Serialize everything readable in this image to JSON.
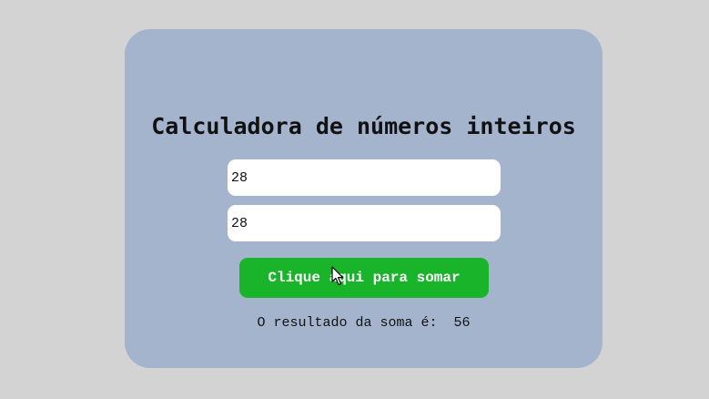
{
  "calculator": {
    "title": "Calculadora de números inteiros",
    "first_number": "28",
    "second_number": "28",
    "sum_button_label": "Clique aqui para somar",
    "result_label": "O resultado da soma é:",
    "result_value": "56"
  },
  "colors": {
    "page_background": "#d3d3d3",
    "card_background": "#a3b4cc",
    "button_background": "#19b429",
    "button_text": "#ffffff"
  },
  "icons": {
    "pointer": "mouse-cursor-icon"
  }
}
